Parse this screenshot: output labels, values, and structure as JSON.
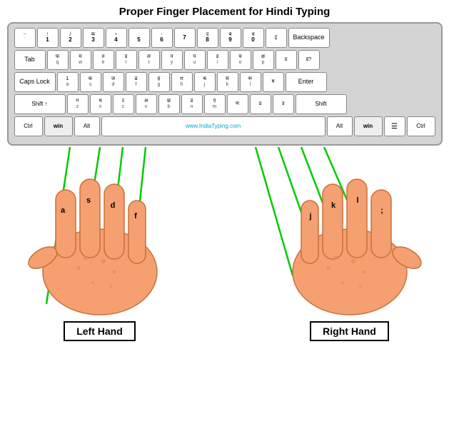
{
  "title": "Proper Finger Placement for Hindi Typing",
  "watermark": "www.IndiaTyping.com",
  "labels": {
    "left_hand": "Left Hand",
    "right_hand": "Right Hand"
  },
  "keys": {
    "row0": [
      "` ~",
      "1 !",
      "2 /",
      "3 क",
      "4 +",
      "5 :",
      "6 -",
      "7",
      "8 द",
      "9 ब",
      "0 ध",
      "ट्र",
      "Backspace"
    ],
    "row1": [
      "Tab",
      "फ",
      "म",
      "त",
      "ड",
      "ल",
      "न",
      "प",
      "ड",
      "च",
      "क्ष",
      "ड",
      "ह?"
    ],
    "row2": [
      "Caps Lock",
      "1",
      "क",
      "ज",
      "ढ",
      "श्र",
      "ज",
      "स",
      "रू",
      "ष",
      "Enter"
    ],
    "row3": [
      "Shift ↑",
      "ग",
      "थ",
      "ट",
      "ठ",
      "छ",
      "ड",
      "ए",
      "ण",
      "ड",
      "Shift"
    ],
    "row4": [
      "Ctrl",
      "win",
      "Alt",
      "SPACE",
      "Alt",
      "win",
      "☰",
      "Ctrl"
    ]
  },
  "finger_labels": {
    "left": [
      "a",
      "s",
      "d",
      "f"
    ],
    "right": [
      "j",
      "k",
      "l",
      ";"
    ]
  }
}
